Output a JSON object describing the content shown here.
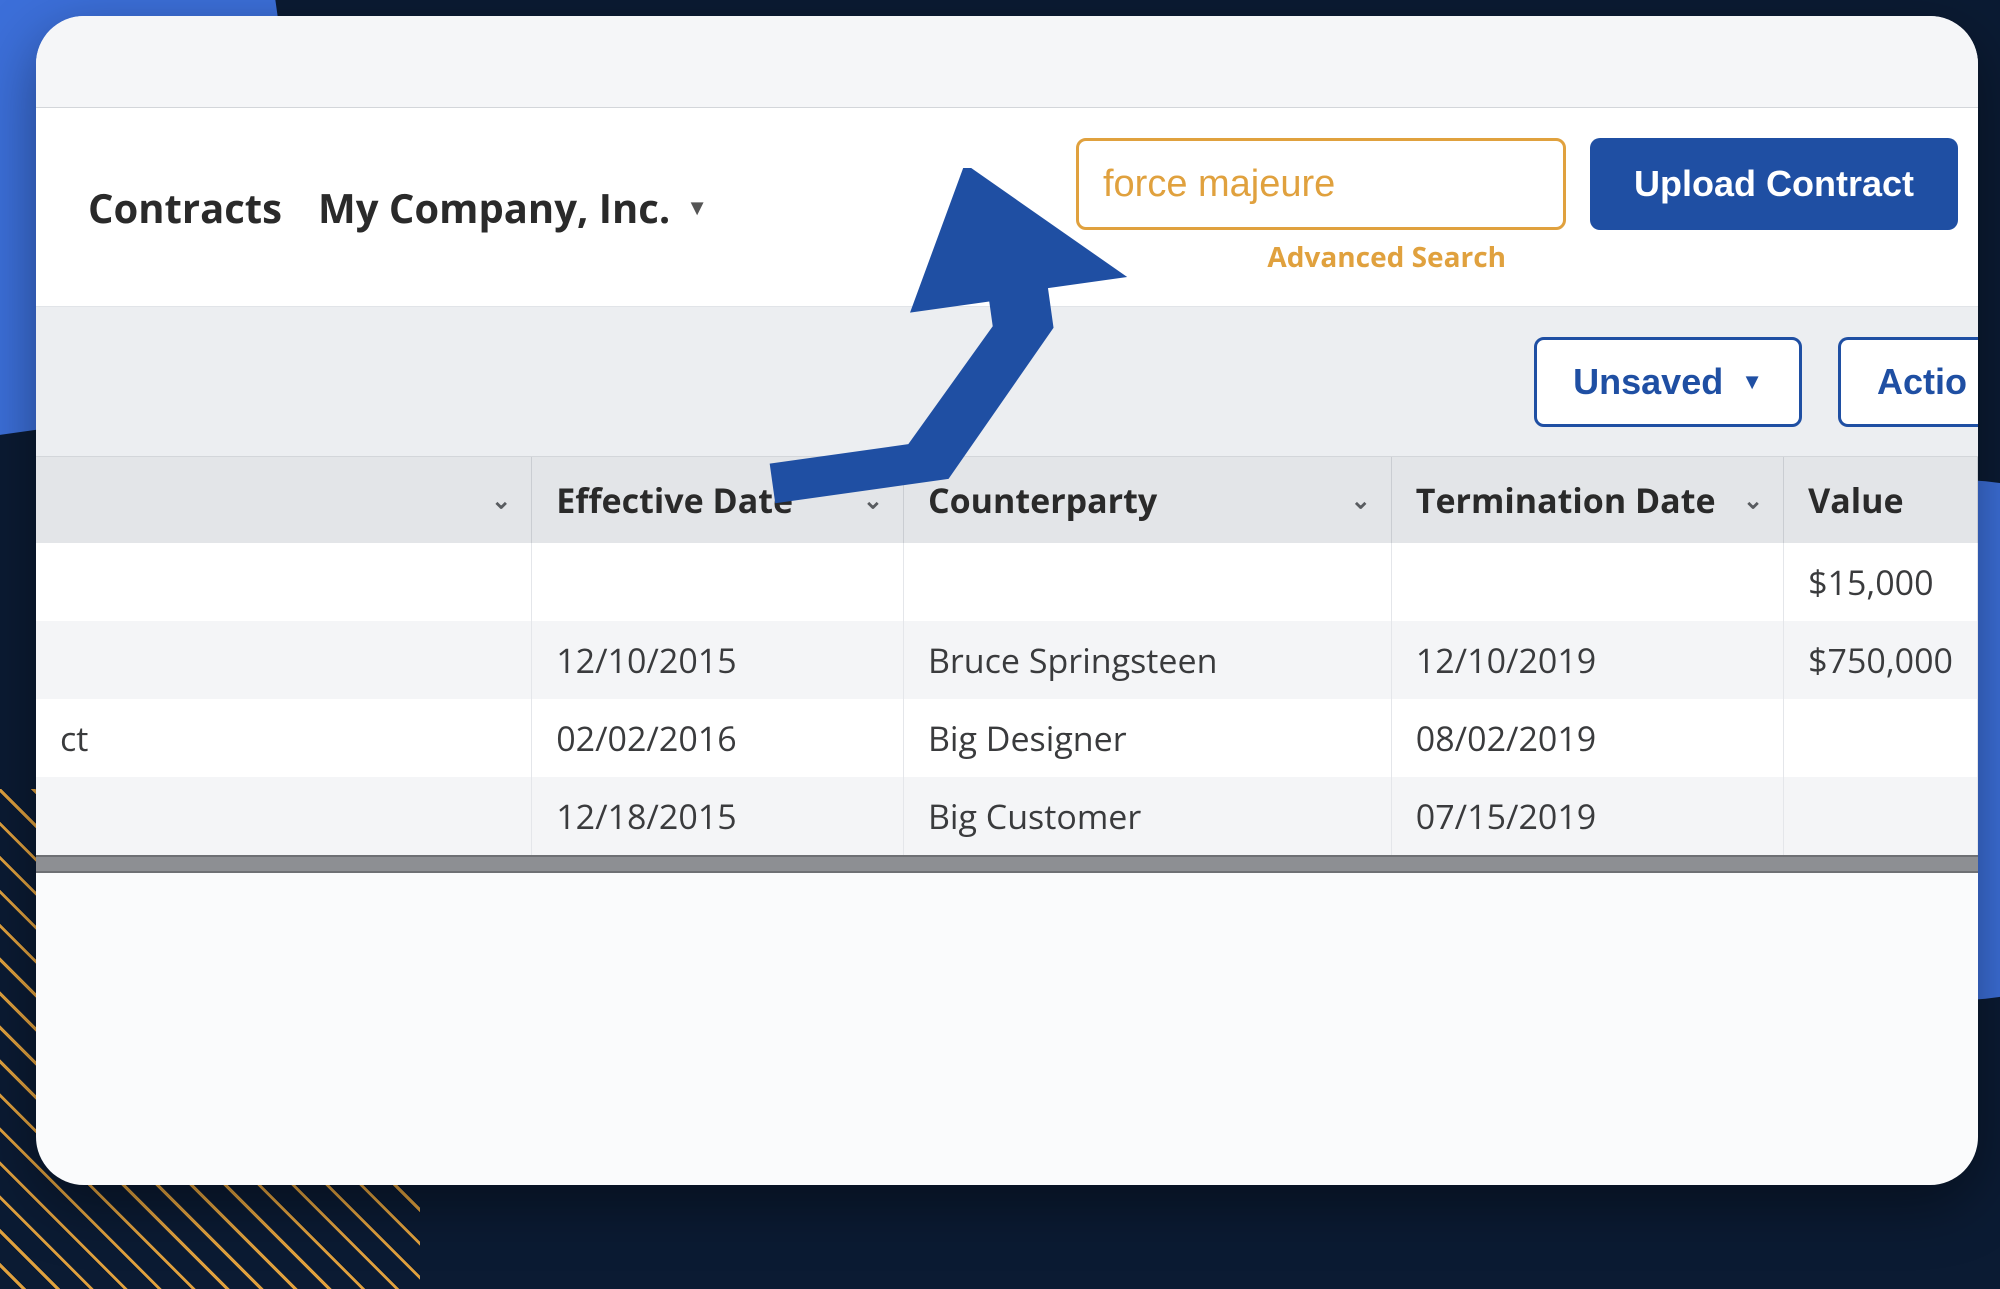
{
  "header": {
    "section_title": "Contracts",
    "company_label": "My Company, Inc.",
    "search_value": "force majeure",
    "advanced_search": "Advanced Search",
    "upload_label": "Upload Contract"
  },
  "toolbar": {
    "unsaved_label": "Unsaved",
    "action_label": "Actio"
  },
  "table": {
    "columns": [
      "",
      "Effective Date",
      "Counterparty",
      "Termination Date",
      "Value"
    ],
    "rows": [
      {
        "name": "",
        "effective": "",
        "counterparty": "",
        "termination": "",
        "value": "$15,000"
      },
      {
        "name": "",
        "effective": "12/10/2015",
        "counterparty": "Bruce Springsteen",
        "termination": "12/10/2019",
        "value": "$750,000"
      },
      {
        "name": "ct",
        "effective": "02/02/2016",
        "counterparty": "Big Designer",
        "termination": "08/02/2019",
        "value": ""
      },
      {
        "name": "",
        "effective": "12/18/2015",
        "counterparty": "Big Customer",
        "termination": "07/15/2019",
        "value": ""
      }
    ]
  }
}
